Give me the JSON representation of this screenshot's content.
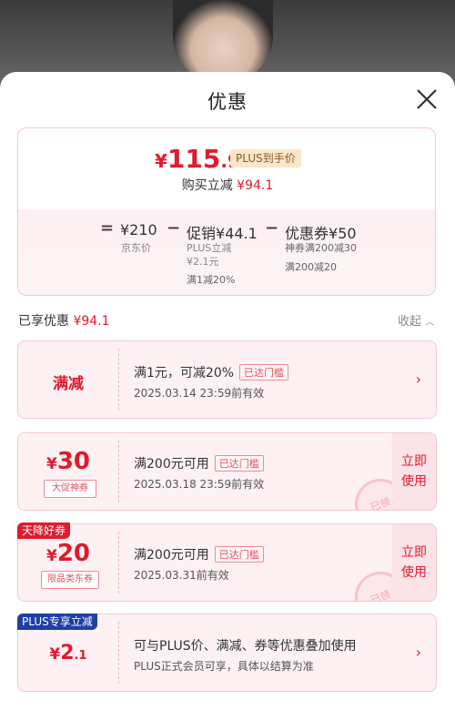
{
  "sheet": {
    "title": "优惠"
  },
  "price": {
    "currency": "¥",
    "final_int": "115",
    "final_dec": ".9",
    "plus_badge": "PLUS到手价",
    "buy_label": "购买立减",
    "buy_amount": "¥94.1"
  },
  "breakdown": {
    "jd_price": "¥210",
    "jd_label": "京东价",
    "promo_title": "促销",
    "promo_amount": "¥44.1",
    "promo_sub1": "PLUS立减",
    "promo_sub2": "¥2.1元",
    "promo_sub3": "满1减20%",
    "coupon_title": "优惠券",
    "coupon_amount": "¥50",
    "coupon_sub1": "神券满200减30",
    "coupon_sub2": "满200减20"
  },
  "enjoyed": {
    "label": "已享优惠",
    "amount": "¥94.1",
    "collapse": "收起"
  },
  "cards": [
    {
      "type": "满减",
      "desc": "满1元，可减20%",
      "reached": "已达门槛",
      "date": "2025.03.14 23:59前有效"
    },
    {
      "value": "30",
      "tag": "大促神券",
      "desc": "满200元可用",
      "reached": "已达门槛",
      "date": "2025.03.18 23:59前有效",
      "action": "立即使用",
      "stamp": "已领"
    },
    {
      "corner": "天降好券",
      "value": "20",
      "tag": "限品类东券",
      "desc": "满200元可用",
      "reached": "已达门槛",
      "date": "2025.03.31前有效",
      "action": "立即使用",
      "stamp": "已领"
    },
    {
      "corner": "PLUS专享立减",
      "value_int": "2",
      "value_dec": ".1",
      "desc": "可与PLUS价、满减、券等优惠叠加使用",
      "date": "PLUS正式会员可享，具体以结算为准"
    }
  ],
  "colors": {
    "accent": "#e01b2e",
    "corner_red": "#e01b2e",
    "corner_blue": "#1f3fa6"
  },
  "icons": {
    "close": "close-icon",
    "chevron": "chevron-right-icon",
    "collapse": "chevron-up-icon"
  }
}
